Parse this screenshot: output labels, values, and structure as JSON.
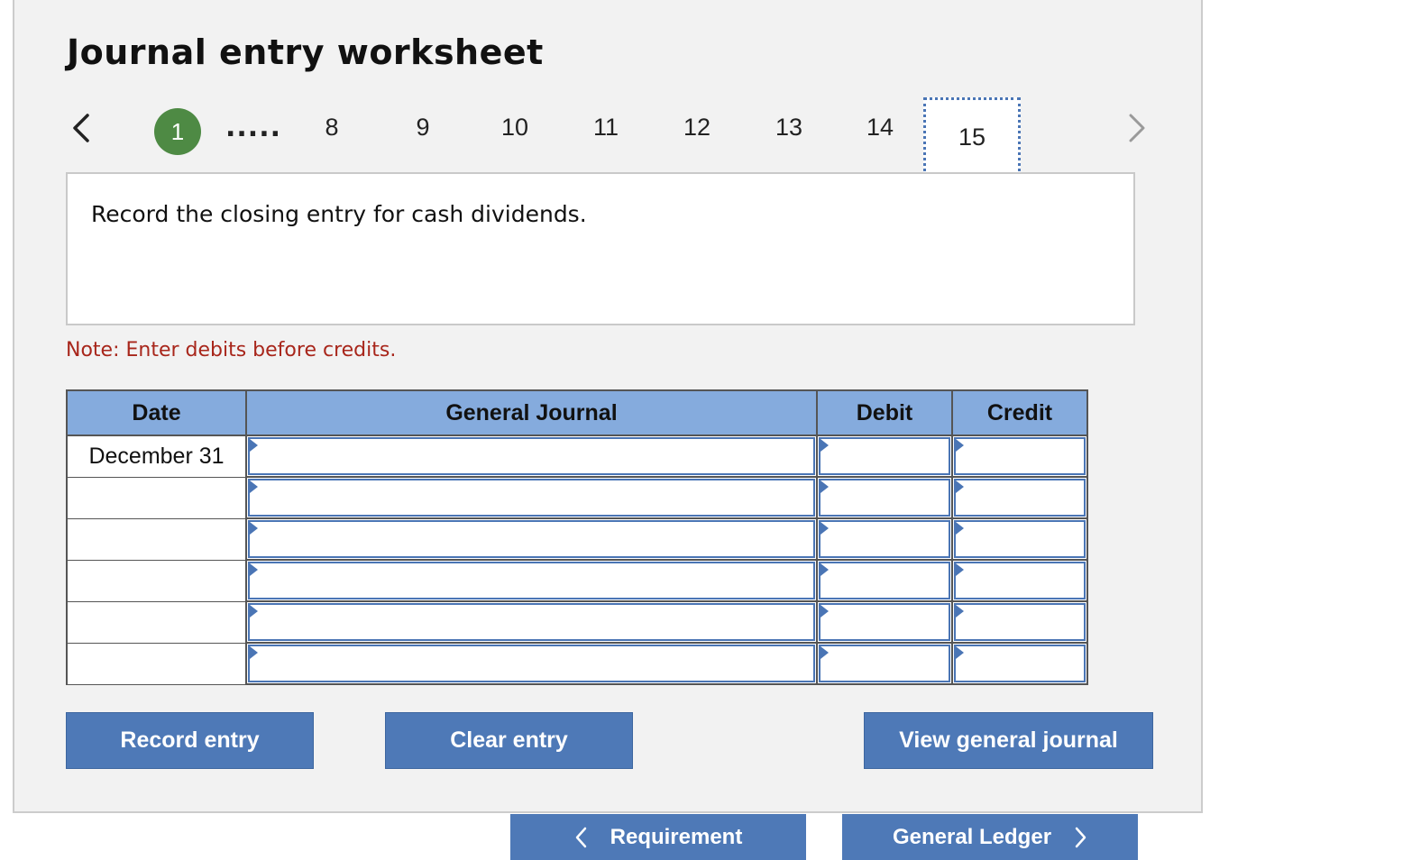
{
  "worksheet": {
    "title": "Journal entry worksheet"
  },
  "pagination": {
    "active_step": "1",
    "ellipsis": ".....",
    "steps": [
      "8",
      "9",
      "10",
      "11",
      "12",
      "13",
      "14"
    ],
    "current_step": "15"
  },
  "question": {
    "text": "Record the closing entry for cash dividends."
  },
  "note": {
    "text": "Note: Enter debits before credits."
  },
  "journal": {
    "headers": {
      "date": "Date",
      "account": "General Journal",
      "debit": "Debit",
      "credit": "Credit"
    },
    "rows": [
      {
        "date": "December 31",
        "account": "",
        "debit": "",
        "credit": ""
      },
      {
        "date": "",
        "account": "",
        "debit": "",
        "credit": ""
      },
      {
        "date": "",
        "account": "",
        "debit": "",
        "credit": ""
      },
      {
        "date": "",
        "account": "",
        "debit": "",
        "credit": ""
      },
      {
        "date": "",
        "account": "",
        "debit": "",
        "credit": ""
      },
      {
        "date": "",
        "account": "",
        "debit": "",
        "credit": ""
      }
    ]
  },
  "buttons": {
    "record": "Record entry",
    "clear": "Clear entry",
    "view_journal": "View general journal"
  },
  "bottom_nav": {
    "prev_label": "Requirement",
    "next_label": "General Ledger"
  },
  "colors": {
    "active_step": "#4e8a44",
    "header_bg": "#85abdd",
    "button_bg": "#4e79b7",
    "note_text": "#a8261b",
    "current_step_border": "#4a75b5"
  },
  "icons": {
    "prev": "chevron-left-icon",
    "next": "chevron-right-icon"
  }
}
